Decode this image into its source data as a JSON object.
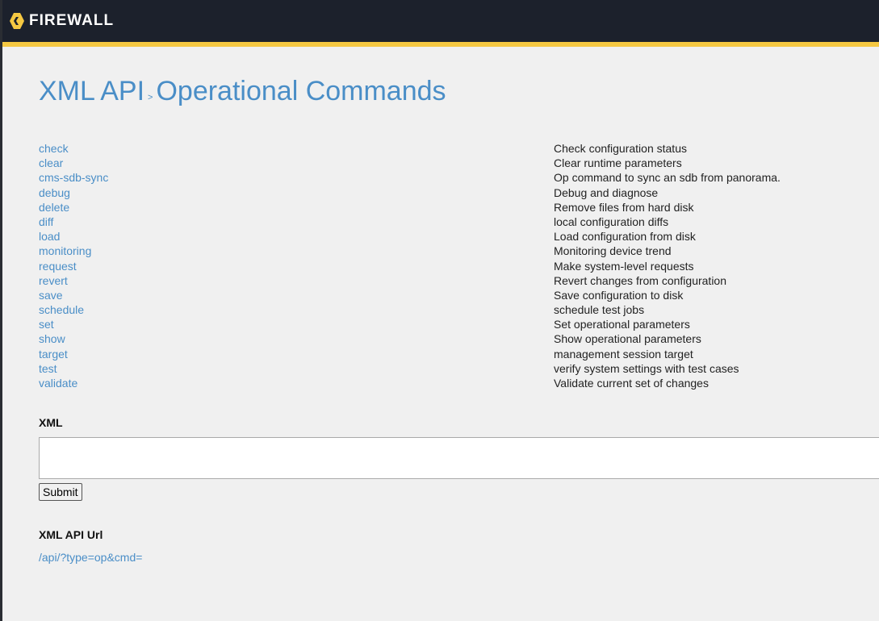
{
  "header": {
    "brand": "FIREWALL"
  },
  "title": {
    "root": "XML API",
    "sep": ">",
    "current": "Operational Commands"
  },
  "commands": [
    {
      "name": "check",
      "desc": "Check configuration status"
    },
    {
      "name": "clear",
      "desc": "Clear runtime parameters"
    },
    {
      "name": "cms-sdb-sync",
      "desc": "Op command to sync an sdb from panorama."
    },
    {
      "name": "debug",
      "desc": "Debug and diagnose"
    },
    {
      "name": "delete",
      "desc": "Remove files from hard disk"
    },
    {
      "name": "diff",
      "desc": "local configuration diffs"
    },
    {
      "name": "load",
      "desc": "Load configuration from disk"
    },
    {
      "name": "monitoring",
      "desc": "Monitoring device trend"
    },
    {
      "name": "request",
      "desc": "Make system-level requests"
    },
    {
      "name": "revert",
      "desc": "Revert changes from configuration"
    },
    {
      "name": "save",
      "desc": "Save configuration to disk"
    },
    {
      "name": "schedule",
      "desc": "schedule test jobs"
    },
    {
      "name": "set",
      "desc": "Set operational parameters"
    },
    {
      "name": "show",
      "desc": "Show operational parameters"
    },
    {
      "name": "target",
      "desc": "management session target"
    },
    {
      "name": "test",
      "desc": "verify system settings with test cases"
    },
    {
      "name": "validate",
      "desc": "Validate current set of changes"
    }
  ],
  "form": {
    "xml_label": "XML",
    "xml_value": "",
    "submit": "Submit",
    "url_label": "XML API Url",
    "url": "/api/?type=op&cmd="
  }
}
